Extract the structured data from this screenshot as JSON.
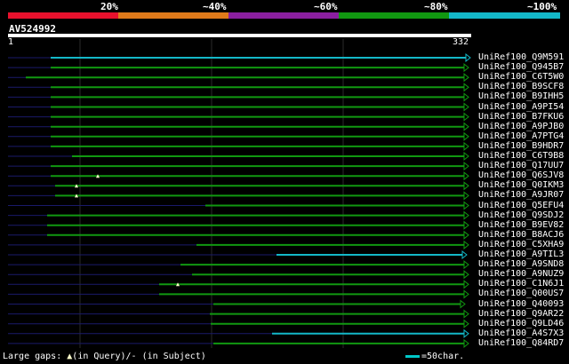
{
  "legend": {
    "labels": [
      "20%",
      "~40%",
      "~60%",
      "~80%",
      "~100%"
    ],
    "colors": [
      "#e8112d",
      "#e07a1a",
      "#8b1fa0",
      "#119811",
      "#13b8c8"
    ]
  },
  "query": {
    "id": "AV524992",
    "start": "1",
    "end": "332"
  },
  "hits": [
    {
      "label": "UniRef100_Q9M591",
      "color": "cyan"
    },
    {
      "label": "UniRef100_Q945B7",
      "color": "green"
    },
    {
      "label": "UniRef100_C6T5W0",
      "color": "green"
    },
    {
      "label": "UniRef100_B9SCF8",
      "color": "green"
    },
    {
      "label": "UniRef100_B9IHH5",
      "color": "green"
    },
    {
      "label": "UniRef100_A9PI54",
      "color": "green"
    },
    {
      "label": "UniRef100_B7FKU6",
      "color": "green"
    },
    {
      "label": "UniRef100_A9PJB0",
      "color": "green"
    },
    {
      "label": "UniRef100_A7PTG4",
      "color": "green"
    },
    {
      "label": "UniRef100_B9HDR7",
      "color": "green"
    },
    {
      "label": "UniRef100_C6T9B8",
      "color": "green"
    },
    {
      "label": "UniRef100_Q17UU7",
      "color": "green"
    },
    {
      "label": "UniRef100_Q6SJV8",
      "color": "green"
    },
    {
      "label": "UniRef100_Q0IKM3",
      "color": "green"
    },
    {
      "label": "UniRef100_A9JR07",
      "color": "green"
    },
    {
      "label": "UniRef100_Q5EFU4",
      "color": "green"
    },
    {
      "label": "UniRef100_Q9SDJ2",
      "color": "green"
    },
    {
      "label": "UniRef100_B9EV82",
      "color": "green"
    },
    {
      "label": "UniRef100_B8ACJ6",
      "color": "green"
    },
    {
      "label": "UniRef100_C5XHA9",
      "color": "green"
    },
    {
      "label": "UniRef100_A9TIL3",
      "color": "cyan"
    },
    {
      "label": "UniRef100_A9SND8",
      "color": "green"
    },
    {
      "label": "UniRef100_A9NUZ9",
      "color": "green"
    },
    {
      "label": "UniRef100_C1N6J1",
      "color": "green"
    },
    {
      "label": "UniRef100_Q00US7",
      "color": "green"
    },
    {
      "label": "UniRef100_Q40093",
      "color": "green"
    },
    {
      "label": "UniRef100_Q9AR22",
      "color": "green"
    },
    {
      "label": "UniRef100_Q9LD46",
      "color": "green"
    },
    {
      "label": "UniRef100_A4S7X3",
      "color": "cyan"
    },
    {
      "label": "UniRef100_Q84RD7",
      "color": "green"
    }
  ],
  "footer": {
    "gaps_prefix": "Large gaps:",
    "gaps_query": "(in Query)/",
    "gaps_subject": "- (in Subject)"
  },
  "scale_text": "=50char."
}
